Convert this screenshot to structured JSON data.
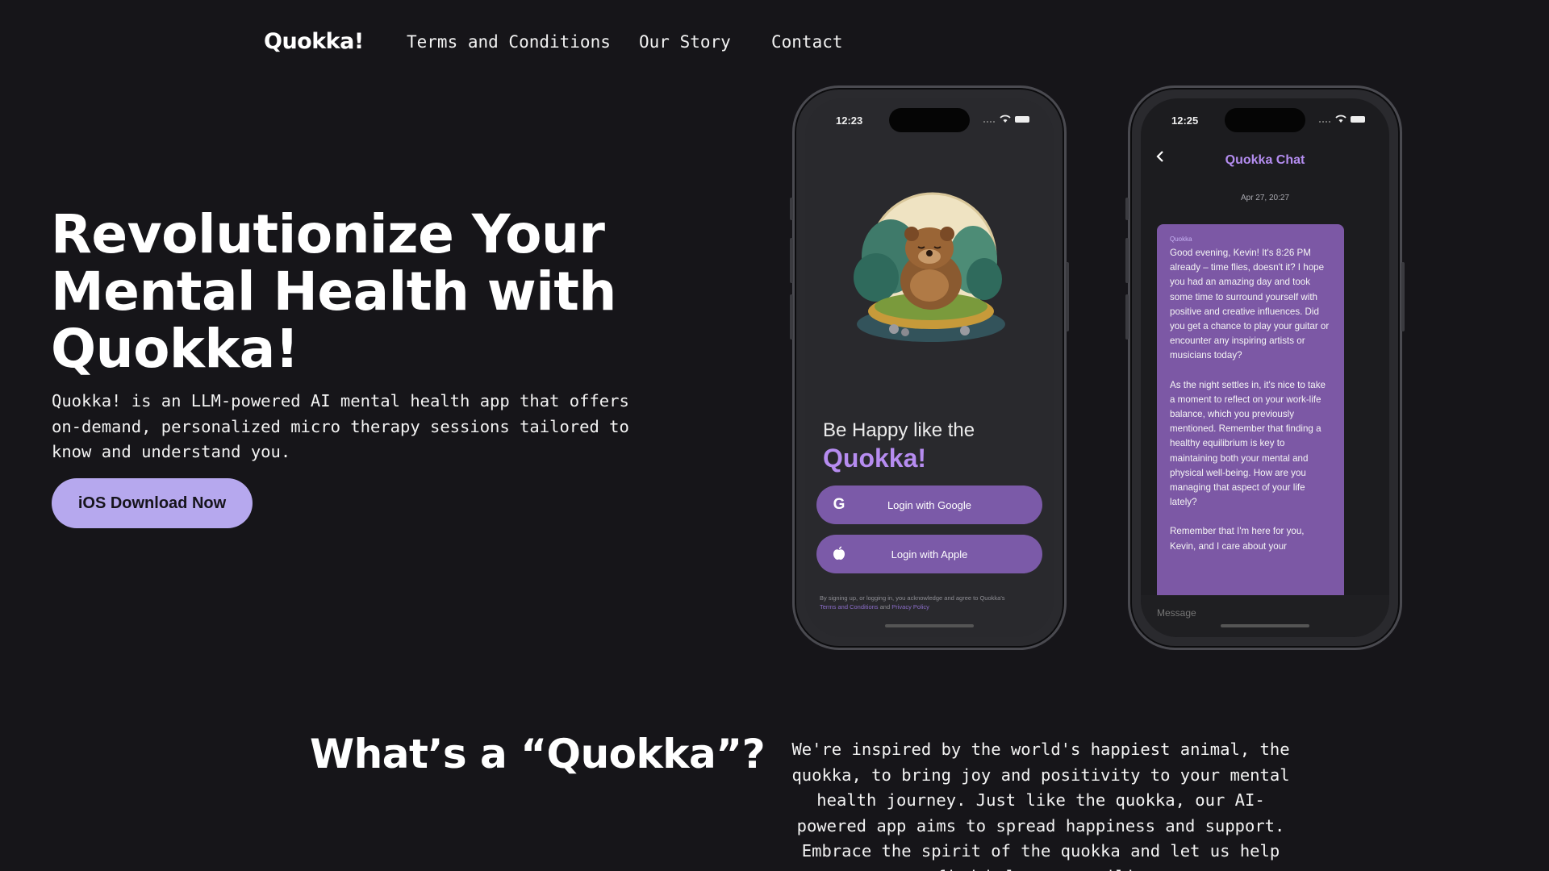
{
  "nav": {
    "brand": "Quokka!",
    "links": [
      "Terms and Conditions",
      "Our Story",
      "Contact"
    ]
  },
  "hero": {
    "title": "Revolutionize Your Mental Health with Quokka!",
    "description": "Quokka! is an LLM-powered AI mental health app that offers on-demand, personalized micro therapy sessions tailored to know and understand you.",
    "cta_label": "iOS Download Now"
  },
  "phone_login": {
    "time": "12:23",
    "tagline": "Be Happy like the",
    "brand": "Quokka!",
    "google_label": "Login with Google",
    "apple_label": "Login with Apple",
    "legal_text": "By signing up, or logging in, you acknowledge and agree to Quokka's",
    "legal_terms": "Terms and Conditions",
    "legal_and": "and",
    "legal_privacy": "Privacy Policy",
    "icons": [
      "google-icon",
      "apple-icon",
      "wifi-icon",
      "battery-icon"
    ]
  },
  "phone_chat": {
    "time": "12:25",
    "title": "Quokka Chat",
    "date": "Apr 27, 20:27",
    "sender": "Quokka",
    "paragraphs": [
      "Good evening, Kevin! It's 8:26 PM already – time flies, doesn't it? I hope you had an amazing day and took some time to surround yourself with positive and creative influences. Did you get a chance to play your guitar or encounter any inspiring artists or musicians today?",
      "As the night settles in, it's nice to take a moment to reflect on your work-life balance, which you previously mentioned. Remember that finding a healthy equilibrium is key to maintaining both your mental and physical well-being. How are you managing that aspect of your life lately?",
      "Remember that I'm here for you, Kevin, and I care about your"
    ],
    "message_placeholder": "Message"
  },
  "about": {
    "title": "What’s a “Quokka”?",
    "text": "We're inspired by the world's happiest animal, the quokka, to bring joy and positivity to your mental health journey. Just like the quokka, our AI-powered app aims to spread happiness and support. Embrace the spirit of the quokka and let us help you find balance, resilience,"
  },
  "colors": {
    "background": "#161519",
    "accent": "#b6a8ee",
    "brand_purple": "#b68cf0",
    "button_purple": "#7b5aa8"
  }
}
